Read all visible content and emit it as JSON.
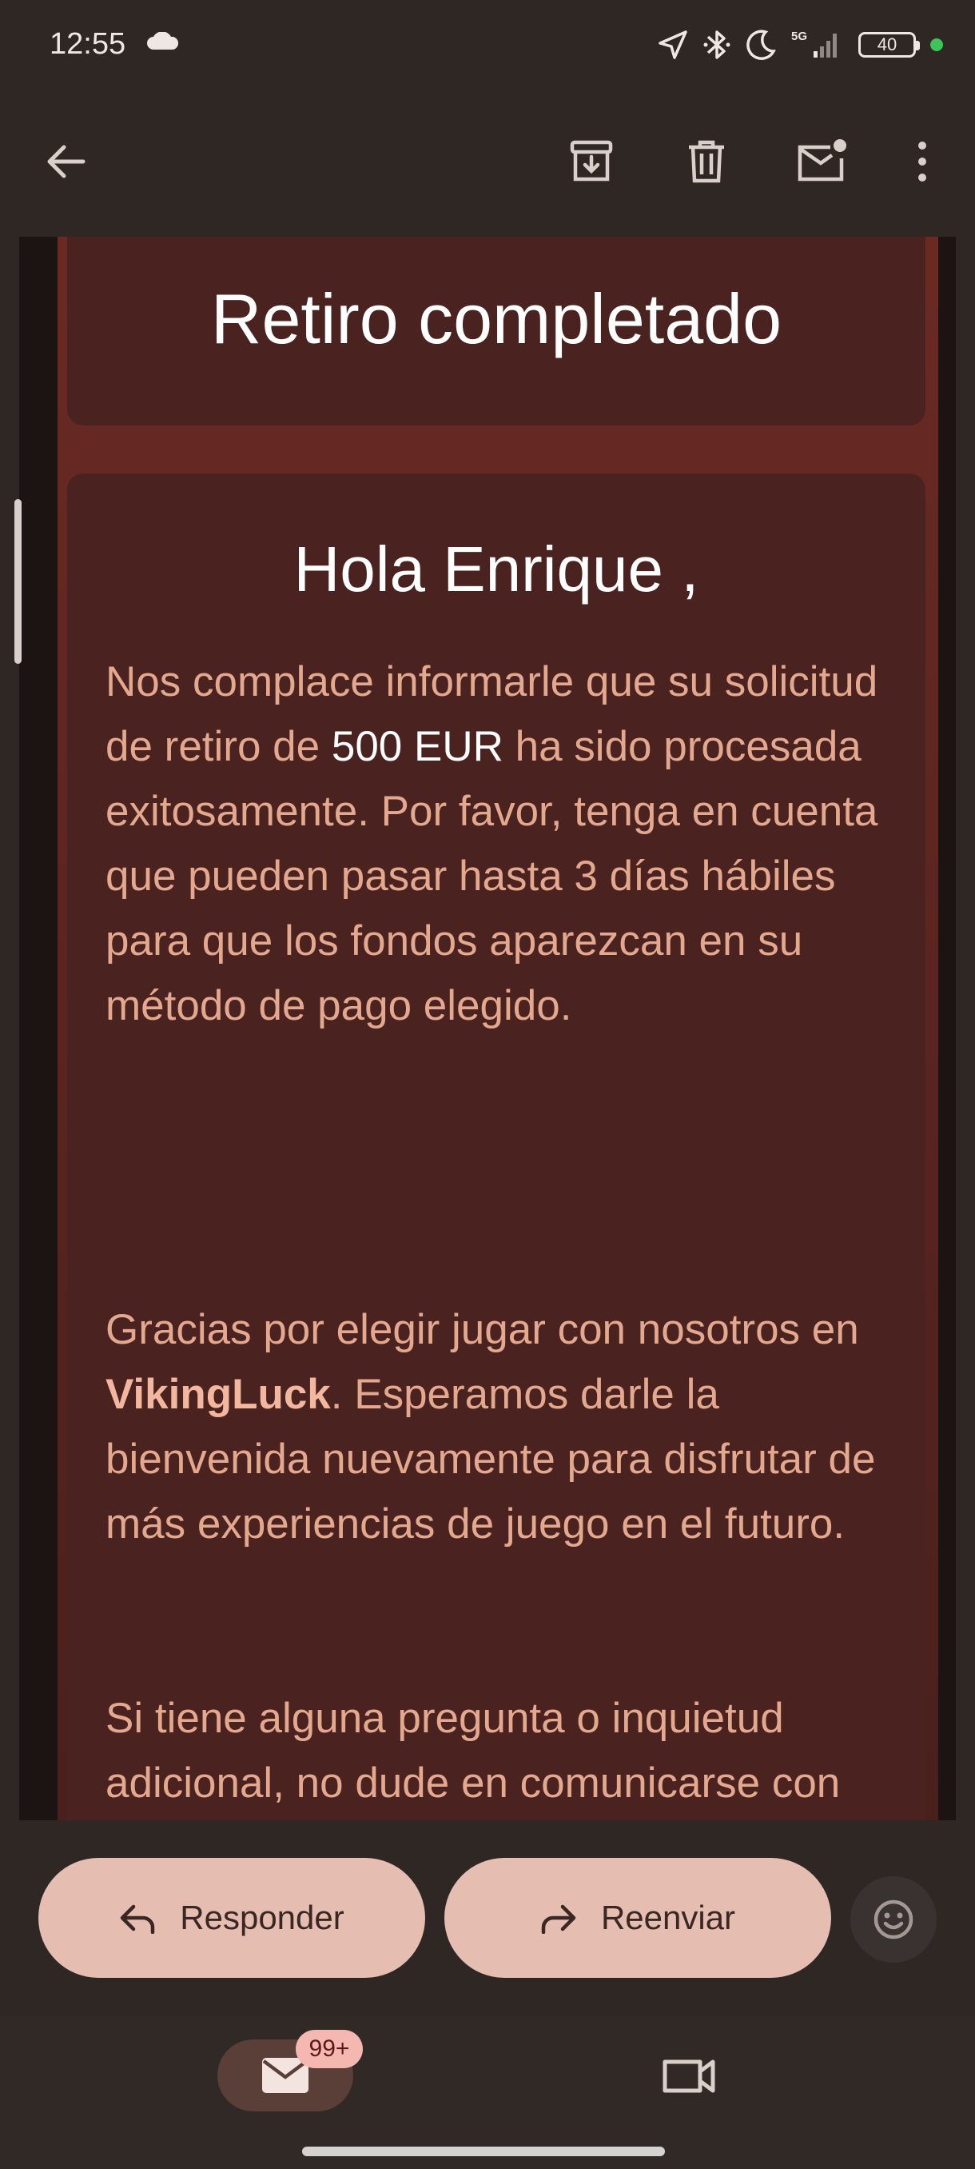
{
  "status_bar": {
    "time": "12:55",
    "network": "5G",
    "battery": "40"
  },
  "email": {
    "banner_title": "Retiro completado",
    "greeting": "Hola Enrique ,",
    "paragraph1": {
      "part1": "Nos complace informarle que su solicitud de retiro de ",
      "amount": "500 EUR",
      "part2": " ha sido procesada exitosamente. Por favor, tenga en cuenta que pueden pasar hasta 3 días hábiles para que los fondos aparezcan en su método de pago elegido."
    },
    "paragraph2": {
      "part1": "Gracias por elegir jugar con nosotros en ",
      "brand": "VikingLuck",
      "part2": ". Esperamos darle la bienvenida nuevamente para disfrutar de más experiencias de juego en el futuro."
    },
    "paragraph3": "Si tiene alguna pregunta o inquietud adicional, no dude en comunicarse con nuestro equipo de atención al cliente."
  },
  "actions": {
    "reply_label": "Responder",
    "forward_label": "Reenviar"
  },
  "bottom_nav": {
    "mail_badge": "99+"
  },
  "colors": {
    "background": "#2e2724",
    "button": "#e6bdb1",
    "email_text": "#e4a88e"
  }
}
